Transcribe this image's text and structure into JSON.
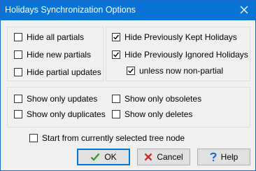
{
  "window": {
    "title": "Holidays Synchronization Options"
  },
  "left_group": {
    "items": [
      {
        "label": "Hide all partials",
        "checked": false
      },
      {
        "label": "Hide new partials",
        "checked": false
      },
      {
        "label": "Hide partial updates",
        "checked": false
      }
    ]
  },
  "right_group": {
    "items": [
      {
        "label": "Hide Previously Kept Holidays",
        "checked": true
      },
      {
        "label": "Hide Previously Ignored Holidays",
        "checked": true
      },
      {
        "label": "unless now non-partial",
        "checked": true
      }
    ]
  },
  "show_group": {
    "items": [
      {
        "label": "Show only updates",
        "checked": false
      },
      {
        "label": "Show only obsoletes",
        "checked": false
      },
      {
        "label": "Show only duplicates",
        "checked": false
      },
      {
        "label": "Show only deletes",
        "checked": false
      }
    ]
  },
  "start_option": {
    "label": "Start from currently selected tree node",
    "checked": false
  },
  "buttons": {
    "ok": "OK",
    "cancel": "Cancel",
    "help": "Help"
  },
  "icons": {
    "close": "close-icon",
    "ok": "checkmark-icon",
    "cancel": "x-icon",
    "help": "question-icon"
  },
  "colors": {
    "titlebar": "#0a74d6",
    "ok_check": "#2a9b2a",
    "cancel_x": "#d21f1f",
    "help_q": "#1a5fd0"
  }
}
